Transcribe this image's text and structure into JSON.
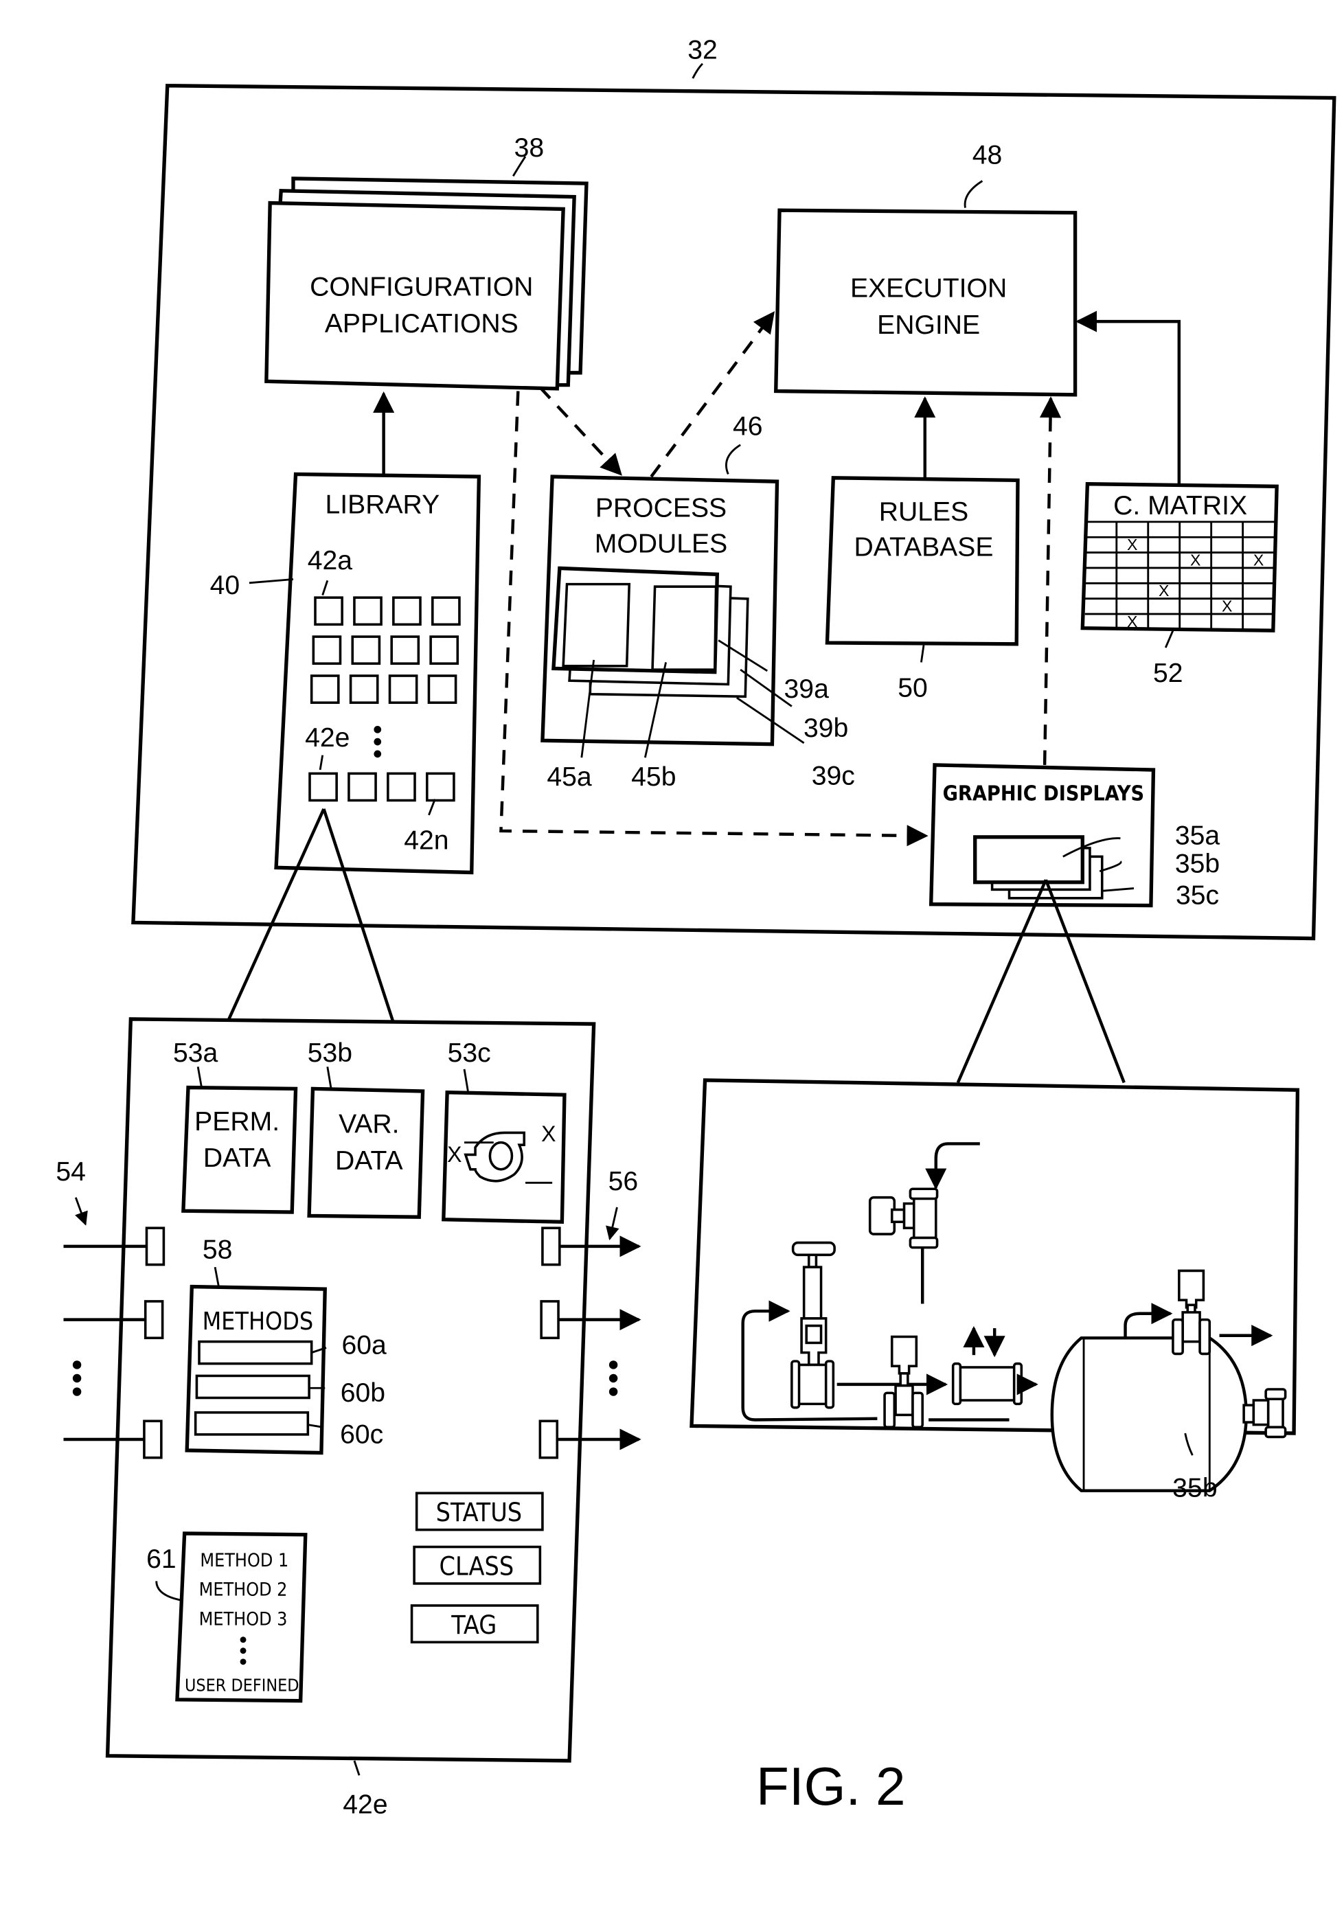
{
  "figure": {
    "caption": "FIG. 2",
    "system_ref": "32"
  },
  "blocks": {
    "config_apps": {
      "title_line1": "CONFIGURATION",
      "title_line2": "APPLICATIONS",
      "ref": "38"
    },
    "execution_engine": {
      "title_line1": "EXECUTION",
      "title_line2": "ENGINE",
      "ref": "48"
    },
    "library": {
      "title": "LIBRARY",
      "ref": "40",
      "first_item_ref": "42a",
      "selected_item_ref": "42e",
      "last_item_ref": "42n",
      "grid_rows": 4,
      "grid_cols": 4
    },
    "process_modules": {
      "title_line1": "PROCESS",
      "title_line2": "MODULES",
      "ref": "46",
      "module_refs": [
        "39a",
        "39b",
        "39c"
      ],
      "element_refs": [
        "45a",
        "45b"
      ]
    },
    "rules_database": {
      "title_line1": "RULES",
      "title_line2": "DATABASE",
      "ref": "50"
    },
    "cause_matrix": {
      "title": "C. MATRIX",
      "ref": "52",
      "rows": 7,
      "cols": 6,
      "marks": [
        [
          1,
          1
        ],
        [
          2,
          3
        ],
        [
          2,
          5
        ],
        [
          4,
          2
        ],
        [
          5,
          4
        ],
        [
          6,
          1
        ]
      ],
      "mark_glyph": "X"
    },
    "graphic_displays": {
      "title": "GRAPHIC DISPLAYS",
      "display_refs": [
        "35a",
        "35b",
        "35c"
      ]
    }
  },
  "smart_object": {
    "ref": "42e",
    "input_ref": "54",
    "output_ref": "56",
    "data_blocks": [
      {
        "ref": "53a",
        "line1": "PERM.",
        "line2": "DATA"
      },
      {
        "ref": "53b",
        "line1": "VAR.",
        "line2": "DATA"
      },
      {
        "ref": "53c",
        "x_left": "X",
        "x_right": "X"
      }
    ],
    "methods": {
      "title": "METHODS",
      "ref": "58",
      "slot_refs": [
        "60a",
        "60b",
        "60c"
      ]
    },
    "method_list": {
      "ref": "61",
      "items": [
        "METHOD 1",
        "METHOD 2",
        "METHOD 3"
      ],
      "last": "USER DEFINED"
    },
    "attributes": [
      "STATUS",
      "CLASS",
      "TAG"
    ]
  },
  "display_detail": {
    "ref": "35b"
  }
}
